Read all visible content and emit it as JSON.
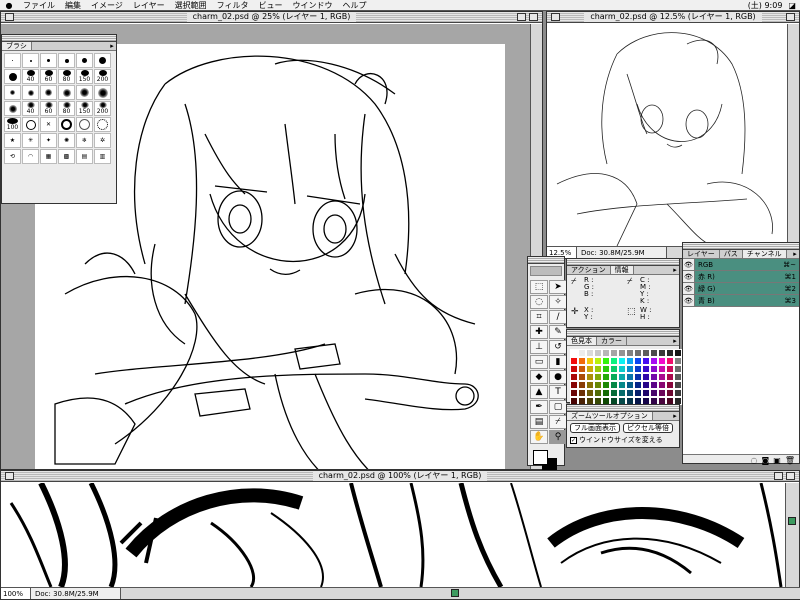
{
  "menubar": {
    "items": [
      "ファイル",
      "編集",
      "イメージ",
      "レイヤー",
      "選択範囲",
      "フィルタ",
      "ビュー",
      "ウインドウ",
      "ヘルプ"
    ],
    "clock": "(土) 9:09"
  },
  "windows": {
    "main": {
      "title": "charm_02.psd @ 25% (レイヤー 1, RGB)"
    },
    "preview": {
      "title": "charm_02.psd @ 12.5% (レイヤー 1, RGB)",
      "zoom": "12.5%",
      "doc": "Doc: 30.8M/25.9M"
    },
    "zoomed": {
      "title": "charm_02.psd @ 100% (レイヤー 1, RGB)",
      "zoom": "100%",
      "doc": "Doc: 30.8M/25.9M"
    }
  },
  "brush_palette": {
    "tab": "ブラシ",
    "sizes_row1": [
      "40",
      "60",
      "80",
      "150",
      "200"
    ],
    "sizes_row2": [
      "40",
      "60",
      "80",
      "150",
      "200"
    ],
    "size_row3": "100"
  },
  "info_palette": {
    "tabs": [
      "アクション",
      "情報"
    ],
    "rgb_labels": [
      "R :",
      "G :",
      "B :"
    ],
    "cmyk_labels": [
      "C :",
      "M :",
      "Y :",
      "K :"
    ],
    "xy_labels": [
      "X :",
      "Y :"
    ],
    "wh_labels": [
      "W :",
      "H :"
    ]
  },
  "swatch_palette": {
    "tabs": [
      "色見本",
      "カラー"
    ]
  },
  "zoom_options": {
    "tab": "ズームツールオプション",
    "fit_button": "フル画面表示",
    "pixel_button": "ピクセル等倍",
    "resize_checkbox": "ウインドウサイズを変える"
  },
  "channel_palette": {
    "tabs": [
      "レイヤー",
      "パス",
      "チャンネル"
    ],
    "channels": [
      {
        "name": "RGB",
        "shortcut": "⌘~"
      },
      {
        "name": "赤 R)",
        "shortcut": "⌘1"
      },
      {
        "name": "緑 G)",
        "shortcut": "⌘2"
      },
      {
        "name": "青 B)",
        "shortcut": "⌘3"
      }
    ]
  },
  "colors": {
    "channel_highlight": "#4a8f80",
    "scroll_thumb": "#3c9a5f"
  }
}
